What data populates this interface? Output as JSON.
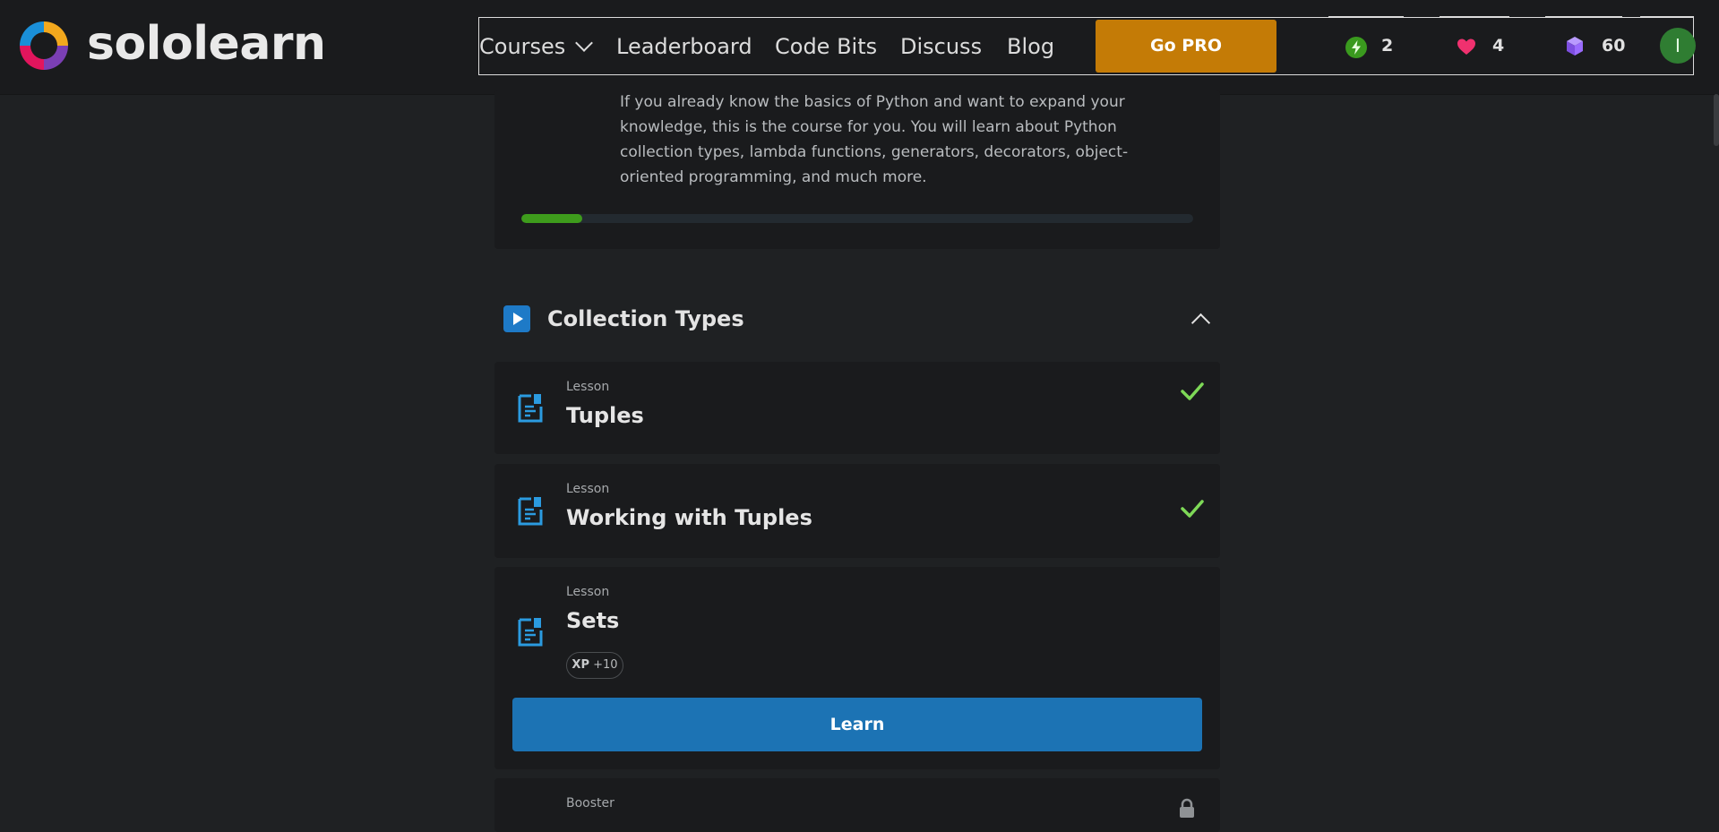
{
  "brand": {
    "name": "sololearn"
  },
  "nav": {
    "courses": "Courses",
    "leaderboard": "Leaderboard",
    "code_bits": "Code Bits",
    "discuss": "Discuss",
    "blog": "Blog",
    "go_pro": "Go PRO"
  },
  "stats": {
    "streak": "2",
    "hearts": "4",
    "gems": "60"
  },
  "user": {
    "avatar_initial": "I"
  },
  "colors": {
    "go_pro": "#c47b06",
    "learn_button": "#1c73b4",
    "progress": "#3e9c1c",
    "check": "#7ed957"
  },
  "course": {
    "description": "If you already know the basics of Python and want to expand your knowledge, this is the course for you. You will learn about Python collection types, lambda functions, generators, decorators, object-oriented programming, and much more.",
    "progress_fraction": 0.09
  },
  "module": {
    "title": "Collection Types",
    "lessons": [
      {
        "kind": "Lesson",
        "title": "Tuples",
        "completed": true
      },
      {
        "kind": "Lesson",
        "title": "Working with Tuples",
        "completed": true
      },
      {
        "kind": "Lesson",
        "title": "Sets",
        "completed": false,
        "xp_label": "XP",
        "xp_value": "+10",
        "action": "Learn"
      },
      {
        "kind": "Booster",
        "locked": true
      }
    ]
  }
}
